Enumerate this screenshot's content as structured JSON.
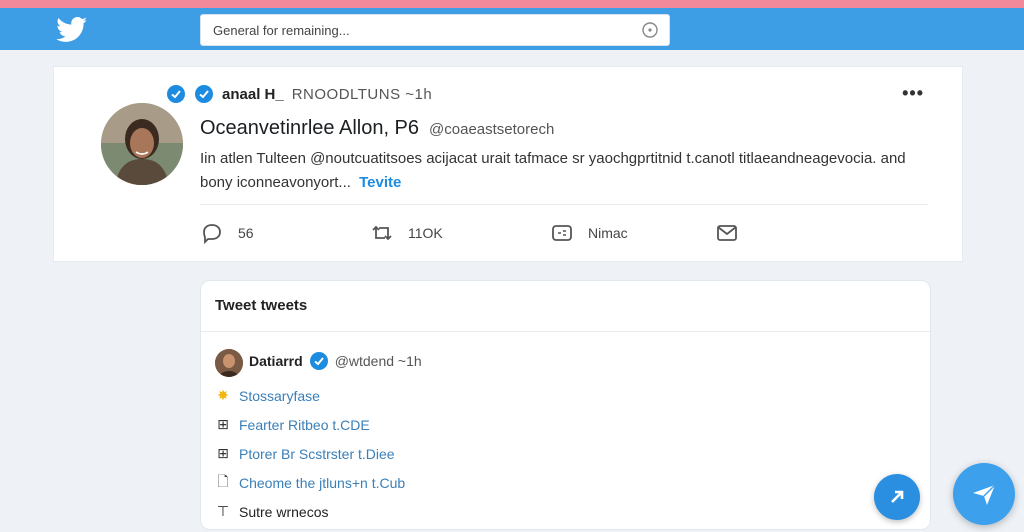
{
  "app": {
    "brand_color": "#3d9ee6",
    "accent_stripe": "#f2899b"
  },
  "header": {
    "logo_icon": "twitter-bird-icon",
    "search": {
      "placeholder": "General for remaining...",
      "icon": "search-icon"
    }
  },
  "tweet": {
    "display_name": "anaal H_",
    "handle_time": "RNOODLTUNS ~1h",
    "headline": "Oceanvetinrlee Allon, P6",
    "headline_handle": "@coaeastsetorech",
    "body": "Iin atlen Tulteen @noutcuatitsoes acijacat urait tafmace sr yaochgprtitnid t.canotl titlaeandneagevocia. and bony iconneavonyort...",
    "more_label": "Tevite",
    "more_icon": "more-dots-icon",
    "actions": {
      "reply": {
        "icon": "reply-icon",
        "count": "56"
      },
      "retweet": {
        "icon": "retweet-icon",
        "count": "11OK"
      },
      "like": {
        "icon": "gif-icon",
        "count": "Nimac"
      },
      "share": {
        "icon": "mail-icon"
      }
    }
  },
  "panel": {
    "title": "Tweet tweets",
    "author": "Datiarrd",
    "handle_time": "@wtdend ~1h",
    "items": [
      {
        "bullet": "✸",
        "label": "Stossaryfase"
      },
      {
        "bullet": "⊞",
        "label": "Fearter Ritbeo t.CDE"
      },
      {
        "bullet": "⊞",
        "label": "Ptorer Br Scstrster t.Diee"
      },
      {
        "bullet": "🗋",
        "label": "Cheome the jtluns+n t.Cub"
      },
      {
        "bullet": "⊤",
        "label": "Sutre wrnecos"
      }
    ]
  },
  "fab": {
    "small_icon": "arrow-icon",
    "large_icon": "send-icon"
  }
}
